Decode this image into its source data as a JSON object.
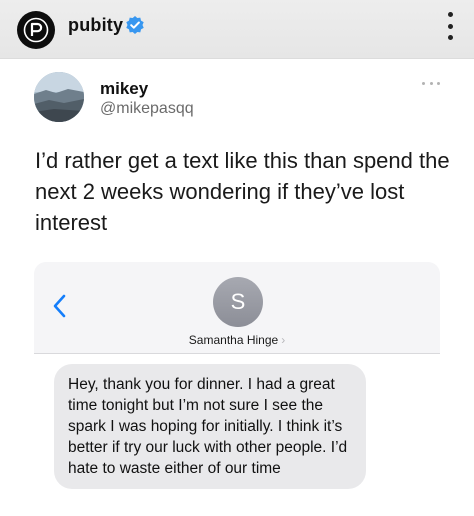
{
  "instagram": {
    "username": "pubity",
    "verified": true,
    "avatar_icon": "pubity-logo-icon",
    "more_icon": "vertical-ellipsis-icon"
  },
  "tweet": {
    "display_name": "mikey",
    "handle": "@mikepasqq",
    "more_icon": "horizontal-ellipsis-icon",
    "text": "I’d rather get a text like this than spend the next 2 weeks wondering if they’ve lost interest"
  },
  "message_screenshot": {
    "back_icon": "chevron-left-icon",
    "contact_initial": "S",
    "contact_name": "Samantha Hinge",
    "contact_chevron": "›",
    "bubble_text": "Hey, thank you for dinner. I had a great time tonight but I’m not sure I see the spark I was hoping for initially. I think it’s better if try our luck with other people. I’d hate to waste either of our time"
  },
  "colors": {
    "verified_blue": "#3897f0",
    "ios_blue": "#147efb",
    "bubble_gray": "#e9e9eb",
    "handle_gray": "#6b6b6b"
  }
}
